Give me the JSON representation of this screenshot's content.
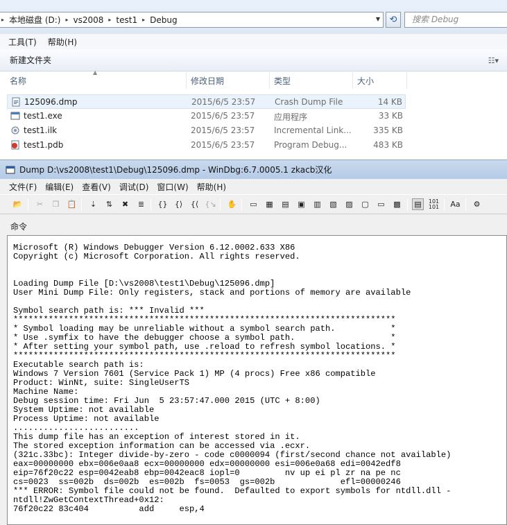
{
  "explorer": {
    "breadcrumbs": [
      "本地磁盘 (D:)",
      "vs2008",
      "test1",
      "Debug"
    ],
    "search_placeholder": "搜索 Debug",
    "menu": [
      "工具(T)",
      "帮助(H)"
    ],
    "new_folder": "新建文件夹",
    "columns": [
      "名称",
      "修改日期",
      "类型",
      "大小"
    ],
    "files": [
      {
        "name": "125096.dmp",
        "date": "2015/6/5 23:57",
        "type": "Crash Dump File",
        "size": "14 KB",
        "icon": "dump-file-icon"
      },
      {
        "name": "test1.exe",
        "date": "2015/6/5 23:57",
        "type": "应用程序",
        "size": "33 KB",
        "icon": "exe-file-icon"
      },
      {
        "name": "test1.ilk",
        "date": "2015/6/5 23:57",
        "type": "Incremental Link...",
        "size": "335 KB",
        "icon": "ilk-file-icon"
      },
      {
        "name": "test1.pdb",
        "date": "2015/6/5 23:57",
        "type": "Program Debug...",
        "size": "483 KB",
        "icon": "pdb-file-icon"
      }
    ]
  },
  "windbg": {
    "title": "Dump D:\\vs2008\\test1\\Debug\\125096.dmp - WinDbg:6.7.0005.1 zkacb汉化",
    "menu": [
      "文件(F)",
      "编辑(E)",
      "查看(V)",
      "调试(D)",
      "窗口(W)",
      "帮助(H)"
    ],
    "command_label": "命令",
    "output": "Microsoft (R) Windows Debugger Version 6.12.0002.633 X86\nCopyright (c) Microsoft Corporation. All rights reserved.\n\n\nLoading Dump File [D:\\vs2008\\test1\\Debug\\125096.dmp]\nUser Mini Dump File: Only registers, stack and portions of memory are available\n\nSymbol search path is: *** Invalid ***\n****************************************************************************\n* Symbol loading may be unreliable without a symbol search path.           *\n* Use .symfix to have the debugger choose a symbol path.                   *\n* After setting your symbol path, use .reload to refresh symbol locations. *\n****************************************************************************\nExecutable search path is:\nWindows 7 Version 7601 (Service Pack 1) MP (4 procs) Free x86 compatible\nProduct: WinNt, suite: SingleUserTS\nMachine Name:\nDebug session time: Fri Jun  5 23:57:47.000 2015 (UTC + 8:00)\nSystem Uptime: not available\nProcess Uptime: not available\n.........................\nThis dump file has an exception of interest stored in it.\nThe stored exception information can be accessed via .ecxr.\n(321c.33bc): Integer divide-by-zero - code c0000094 (first/second chance not available)\neax=00000000 ebx=006e0aa8 ecx=00000000 edx=00000000 esi=006e0a68 edi=0042edf8\neip=76f20c22 esp=0042eab8 ebp=0042eac8 iopl=0         nv up ei pl zr na pe nc\ncs=0023  ss=002b  ds=002b  es=002b  fs=0053  gs=002b             efl=00000246\n*** ERROR: Symbol file could not be found.  Defaulted to export symbols for ntdll.dll -\nntdll!ZwGetContextThread+0x12:\n76f20c22 83c404          add     esp,4"
  }
}
